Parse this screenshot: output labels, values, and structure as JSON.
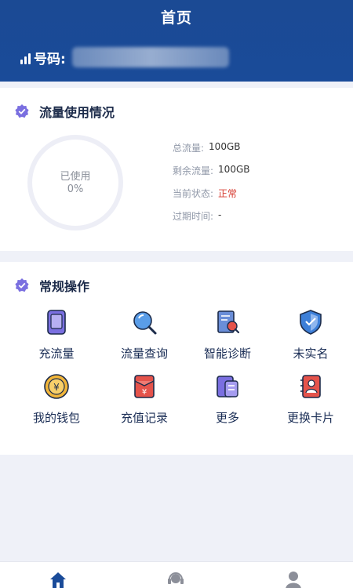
{
  "header": {
    "title": "首页",
    "phone_label": "号码:"
  },
  "usage": {
    "title": "流量使用情况",
    "ring_label": "已使用",
    "ring_value": "0%",
    "used_fraction": 0,
    "stats": [
      {
        "key": "总流量:",
        "value": "100GB"
      },
      {
        "key": "剩余流量:",
        "value": "100GB"
      },
      {
        "key": "当前状态:",
        "value": "正常"
      },
      {
        "key": "过期时间:",
        "value": "-"
      }
    ]
  },
  "ops": {
    "title": "常规操作",
    "items": [
      {
        "label": "充流量",
        "icon": "tablet-icon"
      },
      {
        "label": "流量查询",
        "icon": "magnifier-icon"
      },
      {
        "label": "智能诊断",
        "icon": "diagnosis-icon"
      },
      {
        "label": "未实名",
        "icon": "shield-icon"
      },
      {
        "label": "我的钱包",
        "icon": "coin-icon"
      },
      {
        "label": "充值记录",
        "icon": "red-envelope-icon"
      },
      {
        "label": "更多",
        "icon": "more-icon"
      },
      {
        "label": "更换卡片",
        "icon": "card-icon"
      }
    ]
  },
  "tabbar": {
    "items": [
      {
        "icon": "home-icon",
        "active": true
      },
      {
        "icon": "support-icon",
        "active": false
      },
      {
        "icon": "user-icon",
        "active": false
      }
    ]
  },
  "colors": {
    "brand": "#1a4b99",
    "alert": "#d63a2f",
    "icon_purple": "#7a6fe0",
    "icon_blue": "#3d7fd8",
    "icon_red": "#e5534b",
    "icon_gold": "#f2b63a"
  }
}
